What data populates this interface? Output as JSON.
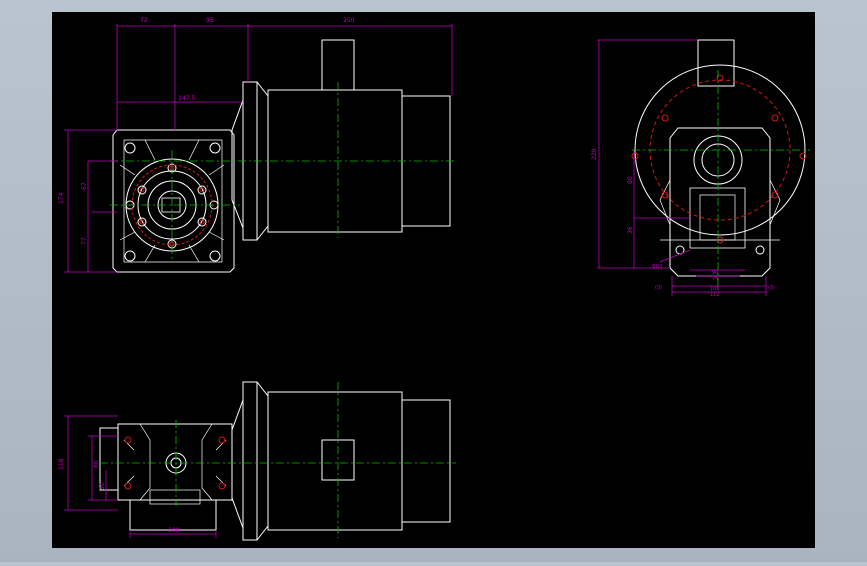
{
  "drawing": {
    "colors": {
      "background": "#000000",
      "outline": "#ffffff",
      "dimension": "#c000c0",
      "centerline": "#00c000",
      "hidden_red": "#d01818"
    },
    "dims_front_top": [
      "72",
      "95",
      "250"
    ],
    "dim_front_inner": "147.5",
    "dims_front_left": [
      "174",
      "67",
      "77"
    ],
    "dim_side_height": "229",
    "dims_side_left": [
      "80",
      "36"
    ],
    "dim_side_bore": "Φ63",
    "dims_side_bottom": [
      "90",
      "74",
      "108",
      "112"
    ],
    "dims_side_marks": [
      "(3)",
      "(3)"
    ],
    "dims_bottom_left": [
      "118",
      "80",
      "50"
    ],
    "dim_bottom_width": "100"
  }
}
